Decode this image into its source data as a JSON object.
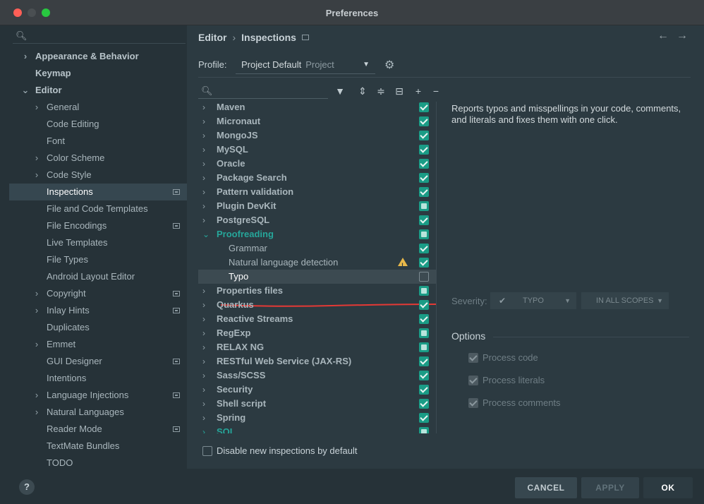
{
  "window": {
    "title": "Preferences"
  },
  "sidebar": {
    "items": [
      {
        "label": "Appearance & Behavior",
        "arrow": "right",
        "level": 0,
        "bold": true
      },
      {
        "label": "Keymap",
        "level": 0,
        "bold": true
      },
      {
        "label": "Editor",
        "arrow": "down",
        "level": 0,
        "bold": true
      },
      {
        "label": "General",
        "arrow": "right",
        "level": 1
      },
      {
        "label": "Code Editing",
        "level": 1
      },
      {
        "label": "Font",
        "level": 1
      },
      {
        "label": "Color Scheme",
        "arrow": "right",
        "level": 1
      },
      {
        "label": "Code Style",
        "arrow": "right",
        "level": 1
      },
      {
        "label": "Inspections",
        "level": 1,
        "selected": true,
        "badge": true
      },
      {
        "label": "File and Code Templates",
        "level": 1
      },
      {
        "label": "File Encodings",
        "level": 1,
        "badge": true
      },
      {
        "label": "Live Templates",
        "level": 1
      },
      {
        "label": "File Types",
        "level": 1
      },
      {
        "label": "Android Layout Editor",
        "level": 1
      },
      {
        "label": "Copyright",
        "arrow": "right",
        "level": 1,
        "badge": true
      },
      {
        "label": "Inlay Hints",
        "arrow": "right",
        "level": 1,
        "badge": true
      },
      {
        "label": "Duplicates",
        "level": 1
      },
      {
        "label": "Emmet",
        "arrow": "right",
        "level": 1
      },
      {
        "label": "GUI Designer",
        "level": 1,
        "badge": true
      },
      {
        "label": "Intentions",
        "level": 1
      },
      {
        "label": "Language Injections",
        "arrow": "right",
        "level": 1,
        "badge": true
      },
      {
        "label": "Natural Languages",
        "arrow": "right",
        "level": 1
      },
      {
        "label": "Reader Mode",
        "level": 1,
        "badge": true
      },
      {
        "label": "TextMate Bundles",
        "level": 1
      },
      {
        "label": "TODO",
        "level": 1
      }
    ]
  },
  "breadcrumb": {
    "parent": "Editor",
    "current": "Inspections"
  },
  "profile": {
    "label": "Profile:",
    "value": "Project Default",
    "scope": "Project"
  },
  "inspections": [
    {
      "label": "Maven",
      "arrow": "right",
      "check": "on"
    },
    {
      "label": "Micronaut",
      "arrow": "right",
      "check": "on"
    },
    {
      "label": "MongoJS",
      "arrow": "right",
      "check": "on"
    },
    {
      "label": "MySQL",
      "arrow": "right",
      "check": "on"
    },
    {
      "label": "Oracle",
      "arrow": "right",
      "check": "on"
    },
    {
      "label": "Package Search",
      "arrow": "right",
      "check": "on"
    },
    {
      "label": "Pattern validation",
      "arrow": "right",
      "check": "on"
    },
    {
      "label": "Plugin DevKit",
      "arrow": "right",
      "check": "partial"
    },
    {
      "label": "PostgreSQL",
      "arrow": "right",
      "check": "on"
    },
    {
      "label": "Proofreading",
      "arrow": "down",
      "check": "partial",
      "accent": true
    },
    {
      "label": "Grammar",
      "child": true,
      "check": "on"
    },
    {
      "label": "Natural language detection",
      "child": true,
      "check": "on",
      "warning": true
    },
    {
      "label": "Typo",
      "child": true,
      "check": "off",
      "selected": true
    },
    {
      "label": "Properties files",
      "arrow": "right",
      "check": "partial"
    },
    {
      "label": "Quarkus",
      "arrow": "right",
      "check": "on"
    },
    {
      "label": "Reactive Streams",
      "arrow": "right",
      "check": "on"
    },
    {
      "label": "RegExp",
      "arrow": "right",
      "check": "partial"
    },
    {
      "label": "RELAX NG",
      "arrow": "right",
      "check": "partial"
    },
    {
      "label": "RESTful Web Service (JAX-RS)",
      "arrow": "right",
      "check": "on"
    },
    {
      "label": "Sass/SCSS",
      "arrow": "right",
      "check": "on"
    },
    {
      "label": "Security",
      "arrow": "right",
      "check": "on"
    },
    {
      "label": "Shell script",
      "arrow": "right",
      "check": "on"
    },
    {
      "label": "Spring",
      "arrow": "right",
      "check": "on"
    },
    {
      "label": "SQL",
      "arrow": "right",
      "check": "partial",
      "accent": true
    }
  ],
  "disable_new": "Disable new inspections by default",
  "description": "Reports typos and misspellings in your code, comments, and literals and fixes them with one click.",
  "severity": {
    "label": "Severity:",
    "value": "TYPO",
    "scope": "IN ALL SCOPES"
  },
  "options": {
    "title": "Options",
    "items": [
      "Process code",
      "Process literals",
      "Process comments"
    ]
  },
  "buttons": {
    "cancel": "CANCEL",
    "apply": "APPLY",
    "ok": "OK",
    "help": "?"
  },
  "colors": {
    "accent": "#26a69a",
    "checkbox": "#1a9c86",
    "annotation": "#e53935"
  }
}
